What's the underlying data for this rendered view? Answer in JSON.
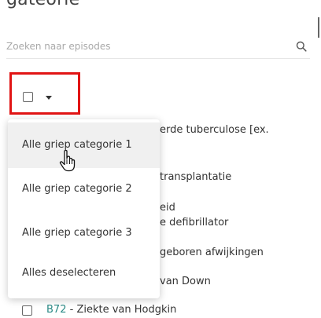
{
  "header": {
    "title_fragment": "gateorie"
  },
  "search": {
    "placeholder": "Zoeken naar episodes",
    "value": "",
    "icon": "search-icon"
  },
  "select_all": {
    "checked": false,
    "caret_icon": "caret-down-icon",
    "highlight_color": "#e11414"
  },
  "dropdown": {
    "items": [
      {
        "label": "Alle griep categorie 1",
        "hovered": true
      },
      {
        "label": "Alle griep categorie 2",
        "hovered": false
      },
      {
        "label": "Alle griep categorie 3",
        "hovered": false
      },
      {
        "label": "Alles deselecteren",
        "hovered": false
      }
    ]
  },
  "list": {
    "visible_fragments": [
      "erde tuberculose [ex.",
      "transplantatie",
      "eid",
      "e defibrillator",
      "geboren afwijkingen",
      "van Down"
    ],
    "last_row": {
      "checked": false,
      "code": "B72",
      "separator": " - ",
      "label": "Ziekte van Hodgkin"
    }
  },
  "colors": {
    "code_accent": "#2a8a86"
  },
  "cursor": {
    "type": "hand-pointer"
  }
}
